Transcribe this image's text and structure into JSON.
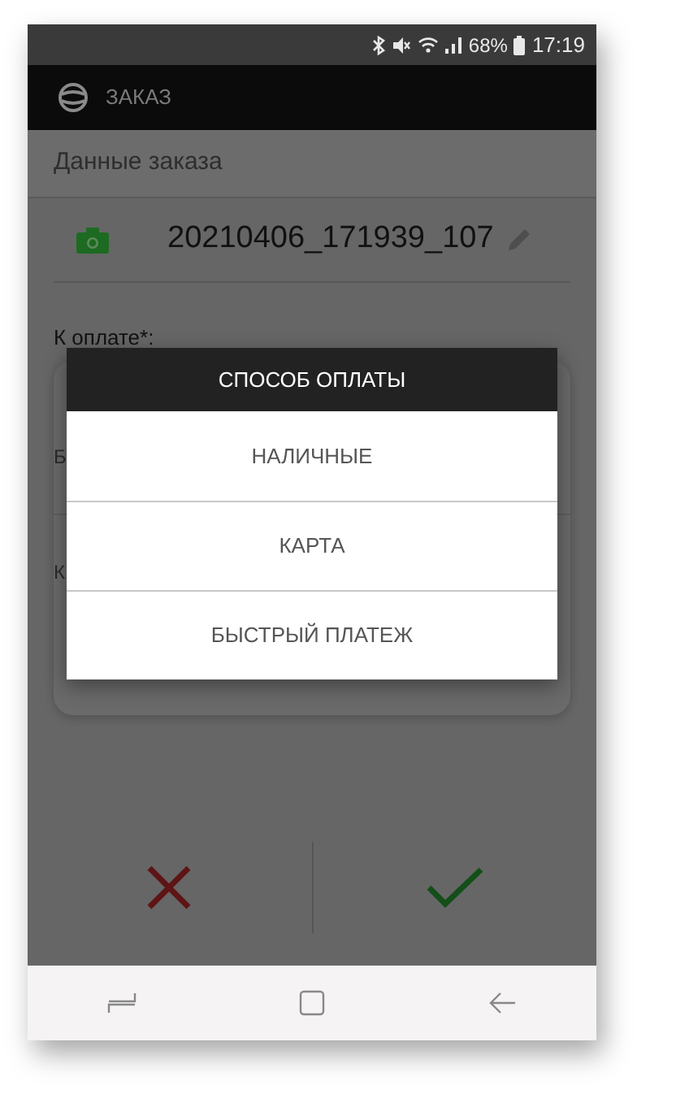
{
  "status_bar": {
    "battery": "68%",
    "time": "17:19"
  },
  "app_bar": {
    "title": "ЗАКАЗ"
  },
  "section": {
    "title": "Данные заказа"
  },
  "order": {
    "number": "20210406_171939_107"
  },
  "form": {
    "label": "К оплате*:",
    "hidden_labels": [
      "Б",
      "К"
    ]
  },
  "dialog": {
    "title": "СПОСОБ ОПЛАТЫ",
    "options": [
      "НАЛИЧНЫЕ",
      "КАРТА",
      "БЫСТРЫЙ ПЛАТЕЖ"
    ]
  },
  "actions": [
    {
      "kind": "cancel"
    },
    {
      "kind": "confirm"
    }
  ],
  "nav_bar": [
    {
      "kind": "recents"
    },
    {
      "kind": "home"
    },
    {
      "kind": "back"
    }
  ]
}
